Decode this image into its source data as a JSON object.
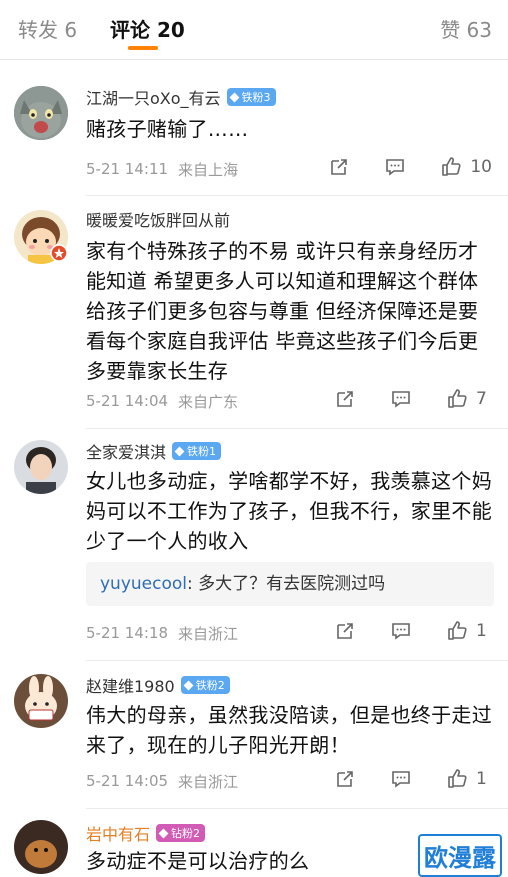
{
  "tabs": {
    "repost": "转发 6",
    "comments": "评论 20",
    "likes": "赞 63"
  },
  "comments": [
    {
      "username": "江湖一只oXo_有云",
      "badge": "铁粉3",
      "text": "赌孩子赌输了……",
      "time": "5-21 14:11",
      "source": "来自上海",
      "likes": "10"
    },
    {
      "username": "暖暖爱吃饭胖回从前",
      "badge": "",
      "text": "家有个特殊孩子的不易 或许只有亲身经历才能知道 希望更多人可以知道和理解这个群体 给孩子们更多包容与尊重 但经济保障还是要看每个家庭自我评估 毕竟这些孩子们今后更多要靠家长生存",
      "time": "5-21 14:04",
      "source": "来自广东",
      "likes": "7"
    },
    {
      "username": "全家爱淇淇",
      "badge": "铁粉1",
      "text": "女儿也多动症，学啥都学不好，我羡慕这个妈妈可以不工作为了孩子，但我不行，家里不能少了一个人的收入",
      "reply_user": "yuyuecool",
      "reply_text": ": 多大了？有去医院测过吗",
      "time": "5-21 14:18",
      "source": "来自浙江",
      "likes": "1"
    },
    {
      "username": "赵建维1980",
      "badge": "铁粉2",
      "text": "伟大的母亲，虽然我没陪读，但是也终于走过来了，现在的儿子阳光开朗！",
      "time": "5-21 14:05",
      "source": "来自浙江",
      "likes": "1"
    },
    {
      "username": "岩中有石",
      "badge": "钻粉2",
      "text": "多动症不是可以治疗的么"
    }
  ],
  "watermark": "欧漫露",
  "colors": {
    "accent": "#ff8200",
    "badge_blue": "#5aa7f2",
    "badge_pink": "#d25bb5",
    "link": "#2e6db4"
  }
}
